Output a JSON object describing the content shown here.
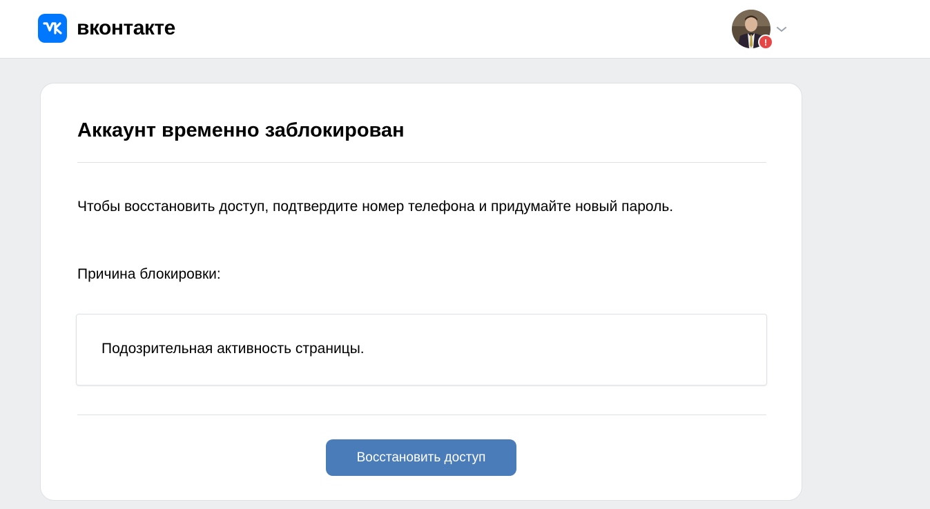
{
  "header": {
    "logo_text": "вконтакте",
    "brand_color": "#0077ff",
    "profile": {
      "alert_icon": "exclamation-icon",
      "alert_symbol": "!",
      "alert_color": "#e64646",
      "menu_icon": "chevron-down-icon"
    }
  },
  "card": {
    "title": "Аккаунт временно заблокирован",
    "message": "Чтобы восстановить доступ, подтвердите номер телефона и придумайте новый пароль.",
    "reason_label": "Причина блокировки:",
    "reason_text": "Подозрительная активность страницы.",
    "restore_button_label": "Восстановить доступ",
    "button_color": "#4a7cba"
  }
}
